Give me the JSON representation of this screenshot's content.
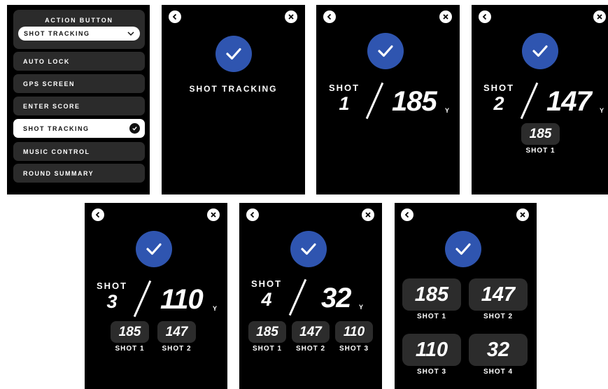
{
  "settings": {
    "header": "ACTION BUTTON",
    "selected_value": "SHOT TRACKING",
    "items": [
      {
        "label": "AUTO LOCK",
        "selected": false
      },
      {
        "label": "GPS SCREEN",
        "selected": false
      },
      {
        "label": "ENTER SCORE",
        "selected": false
      },
      {
        "label": "SHOT TRACKING",
        "selected": true
      },
      {
        "label": "MUSIC CONTROL",
        "selected": false
      },
      {
        "label": "ROUND SUMMARY",
        "selected": false
      }
    ]
  },
  "confirm_screen": {
    "label": "SHOT TRACKING"
  },
  "shot_word": "SHOT",
  "unit": "Y",
  "shot_screens": [
    {
      "shot": "1",
      "distance": "185",
      "history": []
    },
    {
      "shot": "2",
      "distance": "147",
      "history": [
        {
          "value": "185",
          "label": "SHOT 1"
        }
      ]
    },
    {
      "shot": "3",
      "distance": "110",
      "history": [
        {
          "value": "185",
          "label": "SHOT 1"
        },
        {
          "value": "147",
          "label": "SHOT 2"
        }
      ]
    },
    {
      "shot": "4",
      "distance": "32",
      "history": [
        {
          "value": "185",
          "label": "SHOT 1"
        },
        {
          "value": "147",
          "label": "SHOT 2"
        },
        {
          "value": "110",
          "label": "SHOT 3"
        }
      ]
    }
  ],
  "summary": [
    {
      "value": "185",
      "label": "SHOT 1"
    },
    {
      "value": "147",
      "label": "SHOT 2"
    },
    {
      "value": "110",
      "label": "SHOT 3"
    },
    {
      "value": "32",
      "label": "SHOT 4"
    }
  ],
  "colors": {
    "accent": "#2f55b0",
    "panel": "#000000",
    "chip": "#2c2c2c"
  },
  "icons": [
    "back-icon",
    "close-icon",
    "checkmark-icon",
    "chevron-down-icon"
  ]
}
